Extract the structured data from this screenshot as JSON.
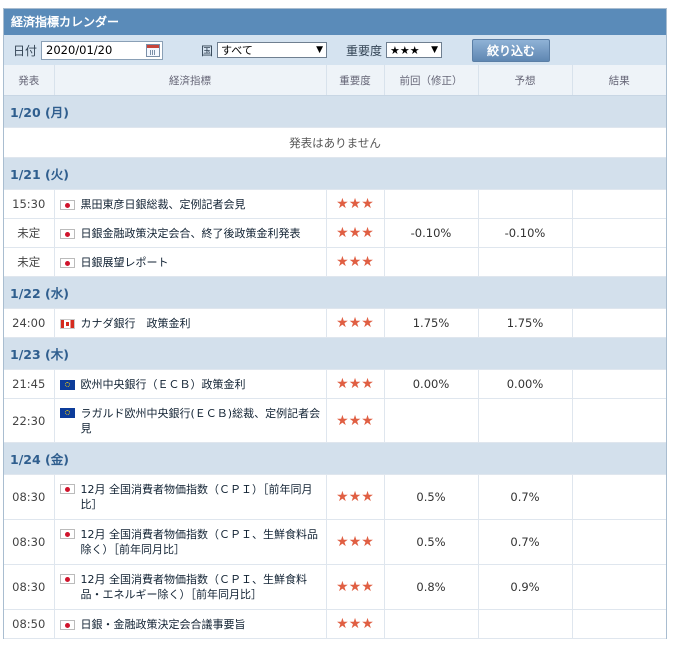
{
  "header": {
    "title": "経済指標カレンダー"
  },
  "filter": {
    "date_label": "日付",
    "date_value": "2020/01/20",
    "country_label": "国",
    "country_value": "すべて",
    "importance_label": "重要度",
    "importance_value": "★★★",
    "submit_label": "絞り込む"
  },
  "columns": [
    "発表",
    "経済指標",
    "重要度",
    "前回（修正）",
    "予想",
    "結果"
  ],
  "days": [
    {
      "date": "1/20 (月)",
      "empty_text": "発表はありません",
      "events": []
    },
    {
      "date": "1/21 (火)",
      "events": [
        {
          "time": "15:30",
          "flag": "jp",
          "name": "黒田東彦日銀総裁、定例記者会見",
          "stars": "★★★",
          "prev": "",
          "forecast": "",
          "result": ""
        },
        {
          "time": "未定",
          "flag": "jp",
          "name": "日銀金融政策決定会合、終了後政策金利発表",
          "stars": "★★★",
          "prev": "-0.10%",
          "forecast": "-0.10%",
          "result": ""
        },
        {
          "time": "未定",
          "flag": "jp",
          "name": "日銀展望レポート",
          "stars": "★★★",
          "prev": "",
          "forecast": "",
          "result": ""
        }
      ]
    },
    {
      "date": "1/22 (水)",
      "events": [
        {
          "time": "24:00",
          "flag": "ca",
          "name": "カナダ銀行　政策金利",
          "stars": "★★★",
          "prev": "1.75%",
          "forecast": "1.75%",
          "result": ""
        }
      ]
    },
    {
      "date": "1/23 (木)",
      "events": [
        {
          "time": "21:45",
          "flag": "eu",
          "name": "欧州中央銀行（ＥＣＢ）政策金利",
          "stars": "★★★",
          "prev": "0.00%",
          "forecast": "0.00%",
          "result": ""
        },
        {
          "time": "22:30",
          "flag": "eu",
          "name": "ラガルド欧州中央銀行(ＥＣＢ)総裁、定例記者会見",
          "stars": "★★★",
          "prev": "",
          "forecast": "",
          "result": ""
        }
      ]
    },
    {
      "date": "1/24 (金)",
      "events": [
        {
          "time": "08:30",
          "flag": "jp",
          "name": "12月 全国消費者物価指数（ＣＰＩ）［前年同月比］",
          "stars": "★★★",
          "prev": "0.5%",
          "forecast": "0.7%",
          "result": ""
        },
        {
          "time": "08:30",
          "flag": "jp",
          "name": "12月 全国消費者物価指数（ＣＰＩ、生鮮食料品除く）［前年同月比］",
          "stars": "★★★",
          "prev": "0.5%",
          "forecast": "0.7%",
          "result": ""
        },
        {
          "time": "08:30",
          "flag": "jp",
          "name": "12月 全国消費者物価指数（ＣＰＩ、生鮮食料品・エネルギー除く）［前年同月比］",
          "stars": "★★★",
          "prev": "0.8%",
          "forecast": "0.9%",
          "result": ""
        },
        {
          "time": "08:50",
          "flag": "jp",
          "name": "日銀・金融政策決定会合議事要旨",
          "stars": "★★★",
          "prev": "",
          "forecast": "",
          "result": ""
        }
      ]
    }
  ]
}
